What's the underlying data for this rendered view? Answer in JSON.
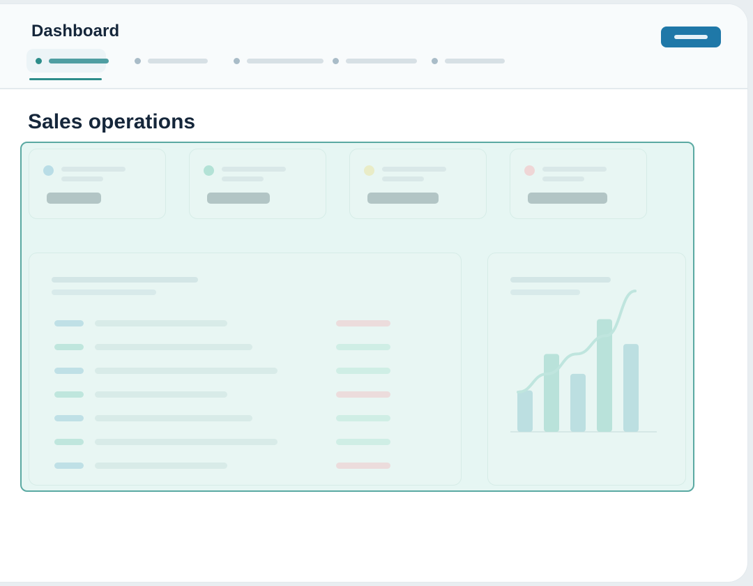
{
  "app": {
    "title": "Dashboard"
  },
  "header": {
    "tabs": [
      {
        "key": "tab-1",
        "active": true
      },
      {
        "key": "tab-2",
        "active": false
      },
      {
        "key": "tab-3",
        "active": false
      },
      {
        "key": "tab-4",
        "active": false
      },
      {
        "key": "tab-5",
        "active": false
      }
    ]
  },
  "page": {
    "title": "Sales operations"
  },
  "kpis": [
    {
      "status_color": "#b9dde6"
    },
    {
      "status_color": "#b3e2d6"
    },
    {
      "status_color": "#e9ecc7"
    },
    {
      "status_color": "#efd6d6"
    }
  ],
  "table_rows": [
    {
      "status": "negative"
    },
    {
      "status": "positive"
    },
    {
      "status": "positive"
    },
    {
      "status": "negative"
    },
    {
      "status": "positive"
    },
    {
      "status": "positive"
    },
    {
      "status": "negative"
    }
  ],
  "chart_data": {
    "type": "bar",
    "values": [
      25,
      47,
      35,
      68,
      53
    ],
    "trend": [
      24,
      35,
      47,
      58,
      85
    ],
    "ylim": [
      0,
      80
    ],
    "colors": {
      "bar": "#bcdfe1",
      "bar_alt": "#b9e2da",
      "trend": "#bfe5de"
    }
  },
  "colors": {
    "accent": "#2d8d8a",
    "primary_button": "#1f78a8",
    "highlight_border": "#5aa9a2",
    "highlight_fill": "#e6f6f3",
    "positive": "#cfeee5",
    "negative": "#ecdcdc"
  }
}
